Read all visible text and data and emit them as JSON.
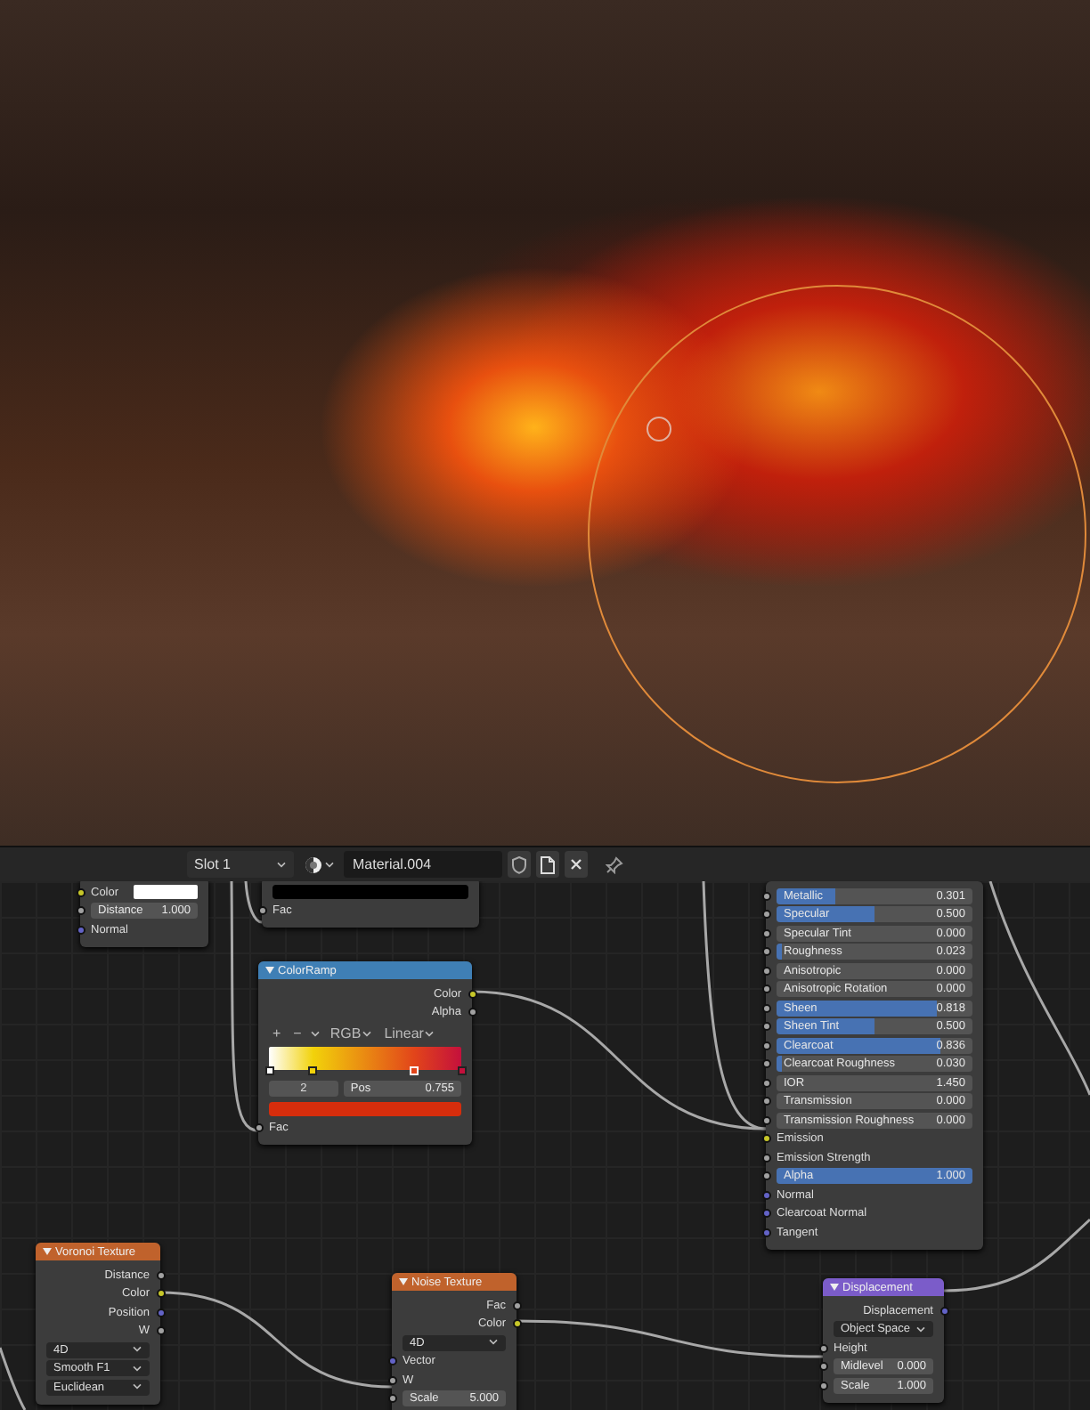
{
  "header": {
    "slot": "Slot 1",
    "material": "Material.004"
  },
  "nodes": [
    {
      "rows": [
        {
          "kind": "color_field",
          "label": "Color",
          "color": "#ffffff"
        },
        {
          "kind": "field",
          "label": "Distance",
          "value": "1.000",
          "color": "#a1a1a1"
        },
        {
          "kind": "input",
          "label": "Normal",
          "color": "#6363c7"
        }
      ]
    },
    {
      "rows": [
        {
          "kind": "swatch",
          "color": "#000000"
        },
        {
          "kind": "input",
          "label": "Fac",
          "color": "#a1a1a1"
        }
      ]
    },
    {
      "title": "ColorRamp",
      "color": "#3f7fb5",
      "rows": [
        {
          "kind": "output",
          "label": "Color",
          "color": "#c7c729"
        },
        {
          "kind": "output",
          "label": "Alpha",
          "color": "#a1a1a1"
        },
        {
          "kind": "ramp",
          "buttons": [
            "+",
            "−"
          ],
          "color_mode": "RGB",
          "interpolation": "Linear",
          "index": "2",
          "pos_label": "Pos",
          "pos_value": "0.755",
          "stops": [
            {
              "color": "#ffffff",
              "level": 0,
              "selected": false
            },
            {
              "color": "#f2d20a",
              "level": 0.23,
              "selected": false
            },
            {
              "color": "#e2451a",
              "level": 0.755,
              "selected": true
            },
            {
              "color": "#c4103c",
              "level": 1,
              "selected": false
            }
          ]
        },
        {
          "kind": "swatch",
          "color": "#d62d0c"
        },
        {
          "kind": "input",
          "label": "Fac",
          "color": "#a1a1a1"
        }
      ]
    },
    {
      "rows": [
        {
          "kind": "slider",
          "label": "Metallic",
          "value": "0.301",
          "level": 0.301,
          "color": "#a1a1a1"
        },
        {
          "kind": "slider",
          "label": "Specular",
          "value": "0.500",
          "level": 0.5,
          "color": "#a1a1a1"
        },
        {
          "kind": "slider",
          "label": "Specular Tint",
          "value": "0.000",
          "level": 0,
          "color": "#a1a1a1"
        },
        {
          "kind": "slider",
          "label": "Roughness",
          "value": "0.023",
          "level": 0.023,
          "color": "#a1a1a1"
        },
        {
          "kind": "slider",
          "label": "Anisotropic",
          "value": "0.000",
          "level": 0,
          "color": "#a1a1a1"
        },
        {
          "kind": "slider",
          "label": "Anisotropic Rotation",
          "value": "0.000",
          "level": 0,
          "color": "#a1a1a1"
        },
        {
          "kind": "slider",
          "label": "Sheen",
          "value": "0.818",
          "level": 0.818,
          "color": "#a1a1a1"
        },
        {
          "kind": "slider",
          "label": "Sheen Tint",
          "value": "0.500",
          "level": 0.5,
          "color": "#a1a1a1"
        },
        {
          "kind": "slider",
          "label": "Clearcoat",
          "value": "0.836",
          "level": 0.836,
          "color": "#a1a1a1"
        },
        {
          "kind": "slider",
          "label": "Clearcoat Roughness",
          "value": "0.030",
          "level": 0.03,
          "color": "#a1a1a1"
        },
        {
          "kind": "field",
          "label": "IOR",
          "value": "1.450",
          "color": "#a1a1a1"
        },
        {
          "kind": "slider",
          "label": "Transmission",
          "value": "0.000",
          "level": 0,
          "color": "#a1a1a1"
        },
        {
          "kind": "slider",
          "label": "Transmission Roughness",
          "value": "0.000",
          "level": 0,
          "color": "#a1a1a1"
        },
        {
          "kind": "input",
          "label": "Emission",
          "color": "#c7c729"
        },
        {
          "kind": "input",
          "label": "Emission Strength",
          "color": "#a1a1a1"
        },
        {
          "kind": "slider",
          "label": "Alpha",
          "value": "1.000",
          "level": 1,
          "color": "#a1a1a1"
        },
        {
          "kind": "input",
          "label": "Normal",
          "color": "#6363c7"
        },
        {
          "kind": "input",
          "label": "Clearcoat Normal",
          "color": "#6363c7"
        },
        {
          "kind": "input",
          "label": "Tangent",
          "color": "#6363c7"
        }
      ]
    },
    {
      "title": "Voronoi Texture",
      "color": "#c0622c",
      "rows": [
        {
          "kind": "output",
          "label": "Distance",
          "color": "#a1a1a1"
        },
        {
          "kind": "output",
          "label": "Color",
          "color": "#c7c729"
        },
        {
          "kind": "output",
          "label": "Position",
          "color": "#6363c7"
        },
        {
          "kind": "output",
          "label": "W",
          "color": "#a1a1a1"
        },
        {
          "kind": "dropdown",
          "value": "4D"
        },
        {
          "kind": "dropdown",
          "value": "Smooth F1"
        },
        {
          "kind": "dropdown",
          "value": "Euclidean"
        }
      ]
    },
    {
      "title": "Noise Texture",
      "color": "#c0622c",
      "rows": [
        {
          "kind": "output",
          "label": "Fac",
          "color": "#a1a1a1"
        },
        {
          "kind": "output",
          "label": "Color",
          "color": "#c7c729"
        },
        {
          "kind": "dropdown",
          "value": "4D"
        },
        {
          "kind": "input",
          "label": "Vector",
          "color": "#6363c7"
        },
        {
          "kind": "input",
          "label": "W",
          "color": "#a1a1a1"
        },
        {
          "kind": "field",
          "label": "Scale",
          "value": "5.000",
          "color": "#a1a1a1"
        }
      ]
    },
    {
      "title": "Displacement",
      "color": "#7b5cc9",
      "rows": [
        {
          "kind": "output",
          "label": "Displacement",
          "color": "#6363c7"
        },
        {
          "kind": "dropdown",
          "value": "Object Space"
        },
        {
          "kind": "input",
          "label": "Height",
          "color": "#a1a1a1"
        },
        {
          "kind": "field",
          "label": "Midlevel",
          "value": "0.000",
          "color": "#a1a1a1"
        },
        {
          "kind": "field",
          "label": "Scale",
          "value": "1.000",
          "color": "#a1a1a1"
        }
      ]
    }
  ]
}
